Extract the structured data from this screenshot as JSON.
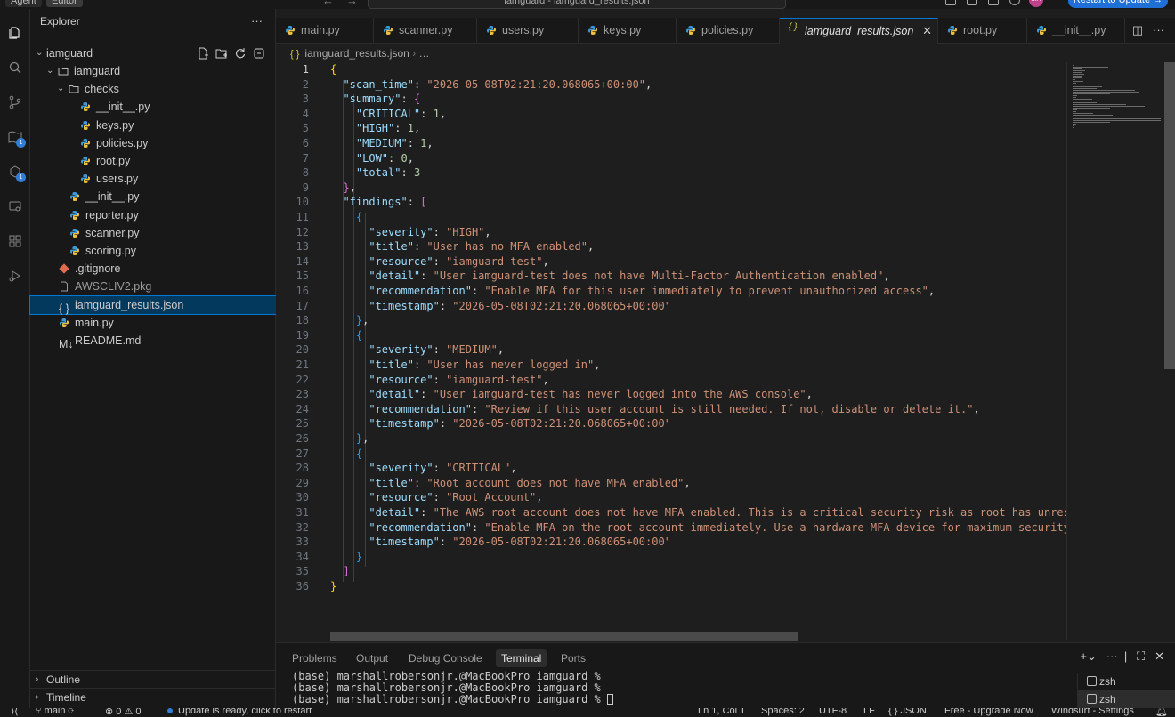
{
  "titlebar": {
    "mode_agent": "Agent",
    "mode_editor": "Editor",
    "search_text": "iamguard - iamguard_results.json",
    "avatar_initials": "MA",
    "update_button": "Restart to Update →"
  },
  "explorer": {
    "title": "Explorer",
    "more": "···",
    "root": "iamguard",
    "items": [
      {
        "label": "iamguard",
        "kind": "folder",
        "depth": 1,
        "open": true
      },
      {
        "label": "checks",
        "kind": "folder",
        "depth": 2,
        "open": true
      },
      {
        "label": "__init__.py",
        "kind": "py",
        "depth": 3
      },
      {
        "label": "keys.py",
        "kind": "py",
        "depth": 3
      },
      {
        "label": "policies.py",
        "kind": "py",
        "depth": 3
      },
      {
        "label": "root.py",
        "kind": "py",
        "depth": 3
      },
      {
        "label": "users.py",
        "kind": "py",
        "depth": 3
      },
      {
        "label": "__init__.py",
        "kind": "py",
        "depth": 2
      },
      {
        "label": "reporter.py",
        "kind": "py",
        "depth": 2
      },
      {
        "label": "scanner.py",
        "kind": "py",
        "depth": 2
      },
      {
        "label": "scoring.py",
        "kind": "py",
        "depth": 2
      },
      {
        "label": ".gitignore",
        "kind": "git",
        "depth": 1
      },
      {
        "label": "AWSCLIV2.pkg",
        "kind": "file",
        "depth": 1
      },
      {
        "label": "iamguard_results.json",
        "kind": "json",
        "depth": 1,
        "selected": true
      },
      {
        "label": "main.py",
        "kind": "py",
        "depth": 1
      },
      {
        "label": "README.md",
        "kind": "md",
        "depth": 1
      }
    ],
    "outline": "Outline",
    "timeline": "Timeline"
  },
  "tabs": [
    {
      "label": "main.py",
      "kind": "py"
    },
    {
      "label": "scanner.py",
      "kind": "py"
    },
    {
      "label": "users.py",
      "kind": "py"
    },
    {
      "label": "keys.py",
      "kind": "py"
    },
    {
      "label": "policies.py",
      "kind": "py"
    },
    {
      "label": "iamguard_results.json",
      "kind": "json",
      "active": true
    },
    {
      "label": "root.py",
      "kind": "py"
    },
    {
      "label": "__init__.py",
      "kind": "py"
    }
  ],
  "breadcrumb": {
    "file": "iamguard_results.json",
    "rest": "…"
  },
  "editor": {
    "current_line": 1,
    "lines": [
      [
        [
          "b1",
          "{"
        ]
      ],
      [
        [
          "p",
          "  "
        ],
        [
          "k",
          "\"scan_time\""
        ],
        [
          "p",
          ": "
        ],
        [
          "s",
          "\"2026-05-08T02:21:20.068065+00:00\""
        ],
        [
          "p",
          ","
        ]
      ],
      [
        [
          "p",
          "  "
        ],
        [
          "k",
          "\"summary\""
        ],
        [
          "p",
          ": "
        ],
        [
          "b2",
          "{"
        ]
      ],
      [
        [
          "p",
          "    "
        ],
        [
          "k",
          "\"CRITICAL\""
        ],
        [
          "p",
          ": "
        ],
        [
          "n",
          "1"
        ],
        [
          "p",
          ","
        ]
      ],
      [
        [
          "p",
          "    "
        ],
        [
          "k",
          "\"HIGH\""
        ],
        [
          "p",
          ": "
        ],
        [
          "n",
          "1"
        ],
        [
          "p",
          ","
        ]
      ],
      [
        [
          "p",
          "    "
        ],
        [
          "k",
          "\"MEDIUM\""
        ],
        [
          "p",
          ": "
        ],
        [
          "n",
          "1"
        ],
        [
          "p",
          ","
        ]
      ],
      [
        [
          "p",
          "    "
        ],
        [
          "k",
          "\"LOW\""
        ],
        [
          "p",
          ": "
        ],
        [
          "n",
          "0"
        ],
        [
          "p",
          ","
        ]
      ],
      [
        [
          "p",
          "    "
        ],
        [
          "k",
          "\"total\""
        ],
        [
          "p",
          ": "
        ],
        [
          "n",
          "3"
        ]
      ],
      [
        [
          "p",
          "  "
        ],
        [
          "b2",
          "}"
        ],
        [
          "p",
          ","
        ]
      ],
      [
        [
          "p",
          "  "
        ],
        [
          "k",
          "\"findings\""
        ],
        [
          "p",
          ": "
        ],
        [
          "b2",
          "["
        ]
      ],
      [
        [
          "p",
          "    "
        ],
        [
          "b3",
          "{"
        ]
      ],
      [
        [
          "p",
          "      "
        ],
        [
          "k",
          "\"severity\""
        ],
        [
          "p",
          ": "
        ],
        [
          "s",
          "\"HIGH\""
        ],
        [
          "p",
          ","
        ]
      ],
      [
        [
          "p",
          "      "
        ],
        [
          "k",
          "\"title\""
        ],
        [
          "p",
          ": "
        ],
        [
          "s",
          "\"User has no MFA enabled\""
        ],
        [
          "p",
          ","
        ]
      ],
      [
        [
          "p",
          "      "
        ],
        [
          "k",
          "\"resource\""
        ],
        [
          "p",
          ": "
        ],
        [
          "s",
          "\"iamguard-test\""
        ],
        [
          "p",
          ","
        ]
      ],
      [
        [
          "p",
          "      "
        ],
        [
          "k",
          "\"detail\""
        ],
        [
          "p",
          ": "
        ],
        [
          "s",
          "\"User iamguard-test does not have Multi-Factor Authentication enabled\""
        ],
        [
          "p",
          ","
        ]
      ],
      [
        [
          "p",
          "      "
        ],
        [
          "k",
          "\"recommendation\""
        ],
        [
          "p",
          ": "
        ],
        [
          "s",
          "\"Enable MFA for this user immediately to prevent unauthorized access\""
        ],
        [
          "p",
          ","
        ]
      ],
      [
        [
          "p",
          "      "
        ],
        [
          "k",
          "\"timestamp\""
        ],
        [
          "p",
          ": "
        ],
        [
          "s",
          "\"2026-05-08T02:21:20.068065+00:00\""
        ]
      ],
      [
        [
          "p",
          "    "
        ],
        [
          "b3",
          "}"
        ],
        [
          "p",
          ","
        ]
      ],
      [
        [
          "p",
          "    "
        ],
        [
          "b3",
          "{"
        ]
      ],
      [
        [
          "p",
          "      "
        ],
        [
          "k",
          "\"severity\""
        ],
        [
          "p",
          ": "
        ],
        [
          "s",
          "\"MEDIUM\""
        ],
        [
          "p",
          ","
        ]
      ],
      [
        [
          "p",
          "      "
        ],
        [
          "k",
          "\"title\""
        ],
        [
          "p",
          ": "
        ],
        [
          "s",
          "\"User has never logged in\""
        ],
        [
          "p",
          ","
        ]
      ],
      [
        [
          "p",
          "      "
        ],
        [
          "k",
          "\"resource\""
        ],
        [
          "p",
          ": "
        ],
        [
          "s",
          "\"iamguard-test\""
        ],
        [
          "p",
          ","
        ]
      ],
      [
        [
          "p",
          "      "
        ],
        [
          "k",
          "\"detail\""
        ],
        [
          "p",
          ": "
        ],
        [
          "s",
          "\"User iamguard-test has never logged into the AWS console\""
        ],
        [
          "p",
          ","
        ]
      ],
      [
        [
          "p",
          "      "
        ],
        [
          "k",
          "\"recommendation\""
        ],
        [
          "p",
          ": "
        ],
        [
          "s",
          "\"Review if this user account is still needed. If not, disable or delete it.\""
        ],
        [
          "p",
          ","
        ]
      ],
      [
        [
          "p",
          "      "
        ],
        [
          "k",
          "\"timestamp\""
        ],
        [
          "p",
          ": "
        ],
        [
          "s",
          "\"2026-05-08T02:21:20.068065+00:00\""
        ]
      ],
      [
        [
          "p",
          "    "
        ],
        [
          "b3",
          "}"
        ],
        [
          "p",
          ","
        ]
      ],
      [
        [
          "p",
          "    "
        ],
        [
          "b3",
          "{"
        ]
      ],
      [
        [
          "p",
          "      "
        ],
        [
          "k",
          "\"severity\""
        ],
        [
          "p",
          ": "
        ],
        [
          "s",
          "\"CRITICAL\""
        ],
        [
          "p",
          ","
        ]
      ],
      [
        [
          "p",
          "      "
        ],
        [
          "k",
          "\"title\""
        ],
        [
          "p",
          ": "
        ],
        [
          "s",
          "\"Root account does not have MFA enabled\""
        ],
        [
          "p",
          ","
        ]
      ],
      [
        [
          "p",
          "      "
        ],
        [
          "k",
          "\"resource\""
        ],
        [
          "p",
          ": "
        ],
        [
          "s",
          "\"Root Account\""
        ],
        [
          "p",
          ","
        ]
      ],
      [
        [
          "p",
          "      "
        ],
        [
          "k",
          "\"detail\""
        ],
        [
          "p",
          ": "
        ],
        [
          "s",
          "\"The AWS root account does not have MFA enabled. This is a critical security risk as root has unrestricted a"
        ]
      ],
      [
        [
          "p",
          "      "
        ],
        [
          "k",
          "\"recommendation\""
        ],
        [
          "p",
          ": "
        ],
        [
          "s",
          "\"Enable MFA on the root account immediately. Use a hardware MFA device for maximum security. Never u"
        ]
      ],
      [
        [
          "p",
          "      "
        ],
        [
          "k",
          "\"timestamp\""
        ],
        [
          "p",
          ": "
        ],
        [
          "s",
          "\"2026-05-08T02:21:20.068065+00:00\""
        ]
      ],
      [
        [
          "p",
          "    "
        ],
        [
          "b3",
          "}"
        ]
      ],
      [
        [
          "p",
          "  "
        ],
        [
          "b2",
          "]"
        ]
      ],
      [
        [
          "b1",
          "}"
        ]
      ]
    ]
  },
  "panel": {
    "tabs": [
      {
        "label": "Problems"
      },
      {
        "label": "Output"
      },
      {
        "label": "Debug Console"
      },
      {
        "label": "Terminal",
        "active": true
      },
      {
        "label": "Ports"
      }
    ],
    "terminal_lines": [
      "(base) marshallrobersonjr.@MacBookPro iamguard %",
      "(base) marshallrobersonjr.@MacBookPro iamguard %",
      "(base) marshallrobersonjr.@MacBookPro iamguard %"
    ],
    "terminals": [
      "zsh",
      "zsh"
    ]
  },
  "statusbar": {
    "branch": "main",
    "errors": "0",
    "warnings": "0",
    "update_message": "Update is ready, click to restart",
    "cursor_position": "Ln 1, Col 1",
    "spaces": "Spaces: 2",
    "encoding": "UTF-8",
    "eol": "LF",
    "language": "{ } JSON",
    "plan": "Free - Upgrade Now",
    "settings": "Windsurf - Settings"
  },
  "colors": {
    "accent": "#0078d4",
    "python_icon": "#3b9cdc",
    "json_icon": "#cbcb41",
    "git_icon": "#e06c4f",
    "md_icon": "#519aba"
  }
}
